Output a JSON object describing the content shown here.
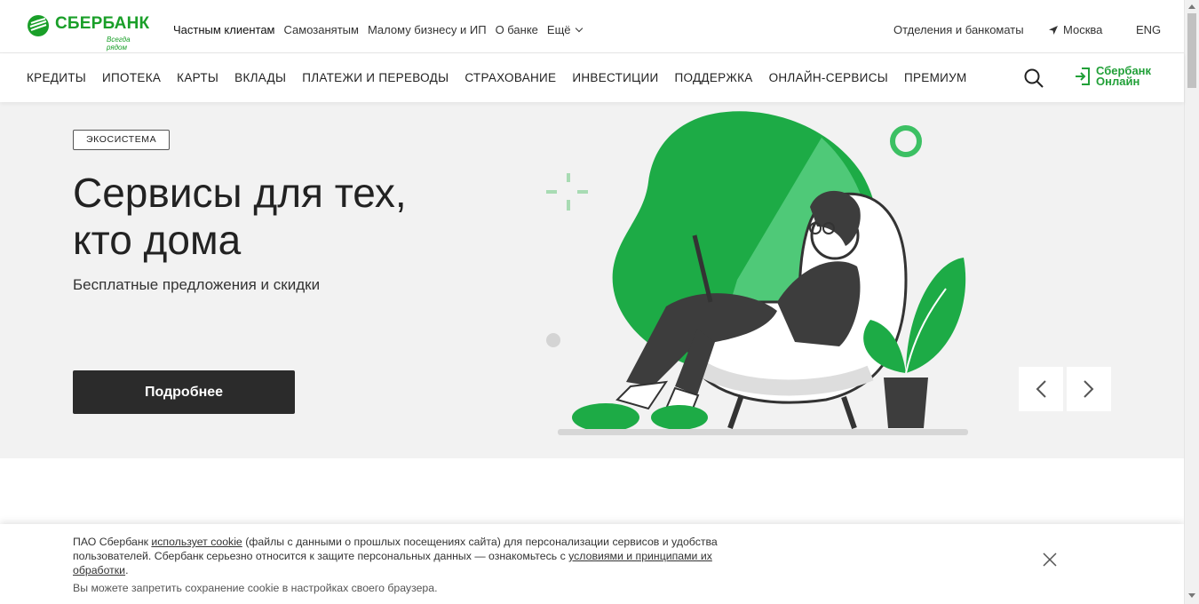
{
  "brand": {
    "name": "СБЕРБАНК",
    "slogan": "Всегда рядом",
    "color": "#1a9f29"
  },
  "topnav": {
    "items": [
      "Частным клиентам",
      "Самозанятым",
      "Малому бизнесу и ИП",
      "О банке"
    ],
    "more_label": "Ещё",
    "offices_label": "Отделения и банкоматы",
    "city": "Москва",
    "lang": "ENG"
  },
  "mainnav": {
    "items": [
      "КРЕДИТЫ",
      "ИПОТЕКА",
      "КАРТЫ",
      "ВКЛАДЫ",
      "ПЛАТЕЖИ И ПЕРЕВОДЫ",
      "СТРАХОВАНИЕ",
      "ИНВЕСТИЦИИ",
      "ПОДДЕРЖКА",
      "ОНЛАЙН-СЕРВИСЫ",
      "ПРЕМИУМ"
    ],
    "online_line1": "Сбербанк",
    "online_line2": "Онлайн",
    "search_icon": "search-icon",
    "login_icon": "login-arrow-icon"
  },
  "hero": {
    "badge": "ЭКОСИСТЕМА",
    "title_line1": "Сервисы для тех,",
    "title_line2": "кто дома",
    "subtitle": "Бесплатные предложения и скидки",
    "button": "Подробнее",
    "accent": "#21a038"
  },
  "cookie": {
    "t1": "ПАО Сбербанк ",
    "link1": "использует cookie",
    "t2": " (файлы с данными о прошлых посещениях сайта) для персонализации сервисов и удобства пользователей. Сбербанк серьезно относится к защите персональных данных — ознакомьтесь с ",
    "link2": "условиями и принципами их обработки",
    "t3": ".",
    "note": "Вы можете запретить сохранение cookie в настройках своего браузера."
  }
}
